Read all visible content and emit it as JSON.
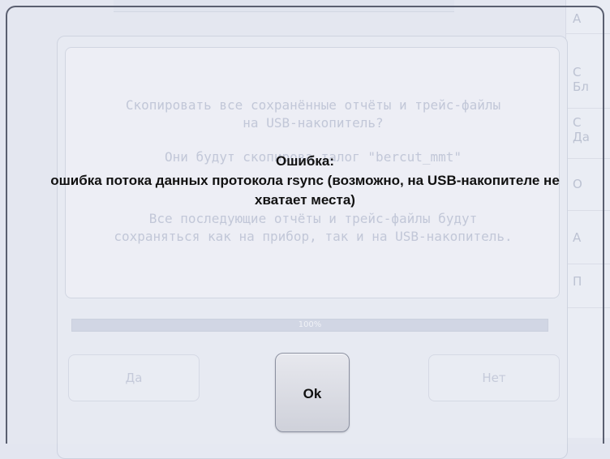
{
  "background": {
    "sidebar_items": [
      "А",
      "С\nБл",
      "С\nДа",
      "О",
      "А",
      "П"
    ],
    "dialog": {
      "lines": [
        "Скопировать все сохранённые отчёты и трейс-файлы",
        "на USB-накопитель?",
        "Они будут скопирова         талог \"bercut_mmt\"",
        "Все последующие отчёты и трейс-файлы будут",
        "сохраняться как на прибор, так и на USB-накопитель."
      ],
      "progress_percent": 100,
      "progress_label": "100%",
      "yes_label": "Да",
      "no_label": "Нет"
    }
  },
  "error": {
    "title": "Ошибка:",
    "message": "ошибка потока данных протокола rsync (возможно, на USB-накопителе не хватает места)",
    "ok_label": "Ok"
  }
}
